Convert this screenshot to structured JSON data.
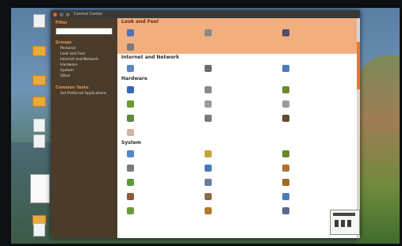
{
  "desktop": {
    "icons": [
      {
        "label": "",
        "kind": "doc"
      },
      {
        "label": "",
        "kind": "folder"
      },
      {
        "label": "",
        "kind": "folder"
      },
      {
        "label": "",
        "kind": "folder"
      },
      {
        "label": "",
        "kind": "doc"
      },
      {
        "label": "",
        "kind": "doc"
      },
      {
        "label": "",
        "kind": "folder"
      },
      {
        "label": "",
        "kind": "doc"
      }
    ]
  },
  "window": {
    "title": "Control Center"
  },
  "sidebar": {
    "filter_heading": "Filter",
    "filter_value": "",
    "groups_heading": "Groups",
    "groups": [
      "Personal",
      "Look and Feel",
      "Internet and Network",
      "Hardware",
      "System",
      "Other"
    ],
    "tasks_heading": "Common Tasks",
    "tasks": [
      "Set Preferred Applications"
    ]
  },
  "sections": [
    {
      "title": "Look and Feel",
      "highlight": true,
      "items": [
        {
          "label": "",
          "icon": "appearance-icon",
          "color": "#4a74b8"
        },
        {
          "label": "",
          "icon": "main-menu-icon",
          "color": "#8a8a8a"
        },
        {
          "label": "",
          "icon": "screensaver-icon",
          "color": "#4c4c6c"
        },
        {
          "label": "",
          "icon": "windows-icon",
          "color": "#7a7a7a"
        }
      ]
    },
    {
      "title": "Internet and Network",
      "highlight": false,
      "items": [
        {
          "label": "",
          "icon": "network-proxy-icon",
          "color": "#5b86c4"
        },
        {
          "label": "",
          "icon": "network-tools-icon",
          "color": "#6d6d6d"
        },
        {
          "label": "",
          "icon": "remote-desktop-icon",
          "color": "#4b7bb8"
        }
      ]
    },
    {
      "title": "Hardware",
      "highlight": false,
      "items": [
        {
          "label": "",
          "icon": "bluetooth-icon",
          "color": "#3566b8"
        },
        {
          "label": "",
          "icon": "keyboard-icon",
          "color": "#8a8a8a"
        },
        {
          "label": "",
          "icon": "display-icon",
          "color": "#6a8a2a"
        },
        {
          "label": "",
          "icon": "additional-drivers-icon",
          "color": "#6a9a2a"
        },
        {
          "label": "",
          "icon": "mouse-icon",
          "color": "#9a9a9a"
        },
        {
          "label": "",
          "icon": "sound-icon",
          "color": "#9a9a9a"
        },
        {
          "label": "",
          "icon": "power-management-icon",
          "color": "#5a8a3a"
        },
        {
          "label": "",
          "icon": "printing-icon",
          "color": "#7a7a7a"
        },
        {
          "label": "",
          "icon": "webcam-icon",
          "color": "#6a4a2a"
        },
        {
          "label": "",
          "icon": "removable-drives-icon",
          "color": "#d3b4a0"
        }
      ]
    },
    {
      "title": "System",
      "highlight": false,
      "items": [
        {
          "label": "",
          "icon": "accessibility-icon",
          "color": "#5b86c4"
        },
        {
          "label": "",
          "icon": "computer-janitor-icon",
          "color": "#c9a23c"
        },
        {
          "label": "",
          "icon": "hardware-drivers-icon",
          "color": "#6a8a2a"
        },
        {
          "label": "",
          "icon": "login-screen-icon",
          "color": "#7a7a7a"
        },
        {
          "label": "",
          "icon": "language-support-icon",
          "color": "#4a78b8"
        },
        {
          "label": "",
          "icon": "software-sources-icon",
          "color": "#b07030"
        },
        {
          "label": "",
          "icon": "synaptic-icon",
          "color": "#5a9a3a"
        },
        {
          "label": "",
          "icon": "time-date-icon",
          "color": "#6a7aa0"
        },
        {
          "label": "",
          "icon": "update-manager-icon",
          "color": "#a06a2a"
        },
        {
          "label": "",
          "icon": "users-groups-icon",
          "color": "#8a5a3a"
        },
        {
          "label": "",
          "icon": "startup-apps-icon",
          "color": "#8a6a4a"
        },
        {
          "label": "",
          "icon": "system-monitor-icon",
          "color": "#4a78b8"
        },
        {
          "label": "",
          "icon": "backup-icon",
          "color": "#6a9a3a"
        },
        {
          "label": "",
          "icon": "printer-config-icon",
          "color": "#b0782a"
        },
        {
          "label": "",
          "icon": "services-icon",
          "color": "#5a6a8a"
        }
      ]
    }
  ],
  "accent": "#f1ae7e",
  "sidebar_bg": "#4a3b2a",
  "scroll_accent": "#e97735"
}
